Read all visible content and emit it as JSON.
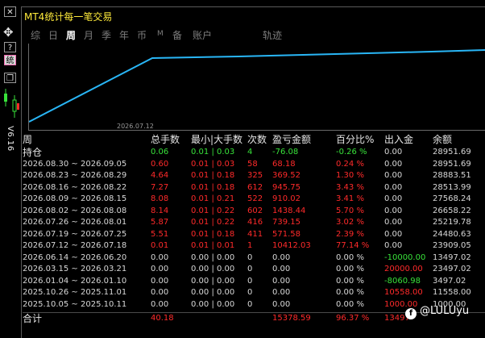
{
  "window": {
    "title": "MT4统计每一笔交易"
  },
  "toolbar": {
    "help_label": "?",
    "stats_label": "统",
    "version_label": "V6.16"
  },
  "tabs": [
    "综",
    "日",
    "周",
    "月",
    "季",
    "年",
    "币",
    "M",
    "备",
    "账户",
    "轨迹"
  ],
  "active_tab_index": 2,
  "chart": {
    "x_label": "2026.07.12",
    "line_color": "#29b6f6"
  },
  "table": {
    "headers": [
      "周",
      "总手数",
      "最小|大手数",
      "次数",
      "盈亏金额",
      "百分比%",
      "出入金",
      "余额"
    ],
    "rows": [
      {
        "period": "持仓",
        "lots": "0.06",
        "minmax": "0.01 | 0.03",
        "count": "4",
        "pnl": "-76.08",
        "pct": "-0.26 %",
        "flow": "0.00",
        "balance": "28951.69",
        "tone": "g"
      },
      {
        "period": "2026.08.30 ~ 2026.09.05",
        "lots": "0.60",
        "minmax": "0.01 | 0.03",
        "count": "58",
        "pnl": "68.18",
        "pct": "0.24 %",
        "flow": "0.00",
        "balance": "28951.69",
        "tone": "r"
      },
      {
        "period": "2026.08.23 ~ 2026.08.29",
        "lots": "4.64",
        "minmax": "0.01 | 0.18",
        "count": "325",
        "pnl": "369.52",
        "pct": "1.30 %",
        "flow": "0.00",
        "balance": "28883.51",
        "tone": "r"
      },
      {
        "period": "2026.08.16 ~ 2026.08.22",
        "lots": "7.27",
        "minmax": "0.01 | 0.18",
        "count": "612",
        "pnl": "945.75",
        "pct": "3.43 %",
        "flow": "0.00",
        "balance": "28513.99",
        "tone": "r"
      },
      {
        "period": "2026.08.09 ~ 2026.08.15",
        "lots": "8.08",
        "minmax": "0.01 | 0.21",
        "count": "522",
        "pnl": "910.02",
        "pct": "3.41 %",
        "flow": "0.00",
        "balance": "27568.24",
        "tone": "r"
      },
      {
        "period": "2026.08.02 ~ 2026.08.08",
        "lots": "8.14",
        "minmax": "0.01 | 0.22",
        "count": "602",
        "pnl": "1438.44",
        "pct": "5.70 %",
        "flow": "0.00",
        "balance": "26658.22",
        "tone": "r"
      },
      {
        "period": "2026.07.26 ~ 2026.08.01",
        "lots": "5.87",
        "minmax": "0.01 | 0.22",
        "count": "416",
        "pnl": "739.15",
        "pct": "3.02 %",
        "flow": "0.00",
        "balance": "25219.78",
        "tone": "r"
      },
      {
        "period": "2026.07.19 ~ 2026.07.25",
        "lots": "5.51",
        "minmax": "0.01 | 0.18",
        "count": "411",
        "pnl": "571.58",
        "pct": "2.39 %",
        "flow": "0.00",
        "balance": "24480.63",
        "tone": "r"
      },
      {
        "period": "2026.07.12 ~ 2026.07.18",
        "lots": "0.01",
        "minmax": "0.01 | 0.01",
        "count": "1",
        "pnl": "10412.03",
        "pct": "77.14 %",
        "flow": "0.00",
        "balance": "23909.05",
        "tone": "r"
      },
      {
        "period": "2026.06.14 ~ 2026.06.20",
        "lots": "0.00",
        "minmax": "0.00 | 0.00",
        "count": "0",
        "pnl": "0.00",
        "pct": "0.00 %",
        "flow": "-10000.00",
        "balance": "13497.02",
        "tone": "w",
        "flow_tone": "g"
      },
      {
        "period": "2026.03.15 ~ 2026.03.21",
        "lots": "0.00",
        "minmax": "0.00 | 0.00",
        "count": "0",
        "pnl": "0.00",
        "pct": "0.00 %",
        "flow": "20000.00",
        "balance": "23497.02",
        "tone": "w",
        "flow_tone": "r"
      },
      {
        "period": "2026.01.04 ~ 2026.01.10",
        "lots": "0.00",
        "minmax": "0.00 | 0.00",
        "count": "0",
        "pnl": "0.00",
        "pct": "0.00 %",
        "flow": "-8060.98",
        "balance": "3497.02",
        "tone": "w",
        "flow_tone": "g"
      },
      {
        "period": "2025.10.26 ~ 2025.11.01",
        "lots": "0.00",
        "minmax": "0.00 | 0.00",
        "count": "0",
        "pnl": "0.00",
        "pct": "0.00 %",
        "flow": "10558.00",
        "balance": "11558.00",
        "tone": "w",
        "flow_tone": "r"
      },
      {
        "period": "2025.10.05 ~ 2025.10.11",
        "lots": "0.00",
        "minmax": "0.00 | 0.00",
        "count": "0",
        "pnl": "0.00",
        "pct": "0.00 %",
        "flow": "1000.00",
        "balance": "1000.00",
        "tone": "w",
        "flow_tone": "r"
      }
    ],
    "total": {
      "label": "合计",
      "lots": "40.18",
      "pnl": "15378.59",
      "pct": "96.37 %",
      "flow": "13497"
    }
  },
  "watermark": {
    "logo": "f",
    "text": "@LULUyu"
  }
}
